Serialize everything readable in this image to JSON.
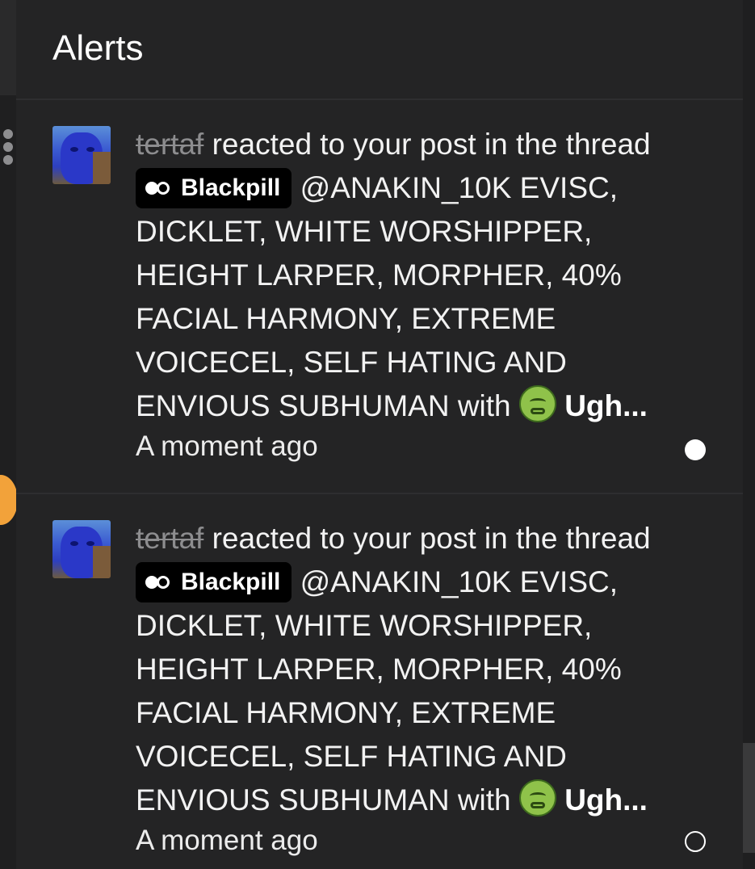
{
  "panel": {
    "title": "Alerts"
  },
  "alerts": [
    {
      "username": "tertaf",
      "action": " reacted to your post in the thread ",
      "prefix": "Blackpill",
      "thread_title": " @ANAKIN_10K EVISC, DICKLET, WHITE WORSHIPPER, HEIGHT LARPER, MORPHER, 40% FACIAL HARMONY, EXTREME VOICECEL, SELF HATING AND ENVIOUS SUBHUMAN with ",
      "reaction": "Ugh...",
      "time": "A moment ago",
      "unread": true
    },
    {
      "username": "tertaf",
      "action": " reacted to your post in the thread ",
      "prefix": "Blackpill",
      "thread_title": " @ANAKIN_10K EVISC, DICKLET, WHITE WORSHIPPER, HEIGHT LARPER, MORPHER, 40% FACIAL HARMONY, EXTREME VOICECEL, SELF HATING AND ENVIOUS SUBHUMAN with ",
      "reaction": "Ugh...",
      "time": "A moment ago",
      "unread": false
    }
  ],
  "icons": {
    "prefix_icon": "pill-icon",
    "reaction_icon": "nauseated-face-icon",
    "unread_marker": "unread-dot-icon",
    "read_marker": "read-circle-icon"
  }
}
